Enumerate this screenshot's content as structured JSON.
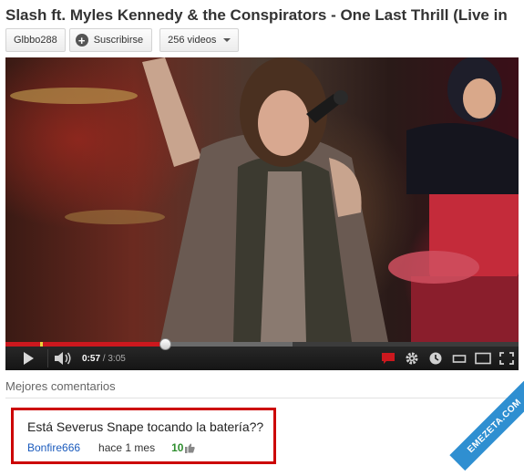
{
  "video": {
    "title": "Slash ft. Myles Kennedy & the Conspirators - One Last Thrill (Live in"
  },
  "channel": {
    "name": "Glbbo288",
    "subscribe_label": "Suscribirse",
    "videos_label": "256 videos"
  },
  "player": {
    "current_time": "0:57",
    "separator": "/",
    "duration": "3:05",
    "played_fraction": 0.31,
    "loaded_fraction": 0.56,
    "accent_color": "#cc181e"
  },
  "comments": {
    "section_label": "Mejores comentarios",
    "top": {
      "text": "Está Severus Snape tocando la batería??",
      "user": "Bonfire666",
      "time": "hace 1 mes",
      "likes": "10"
    }
  },
  "watermark": {
    "text": "EMEZETA.COM",
    "color": "#2f8fd1"
  },
  "icons": [
    "plus-icon",
    "chevron-down-icon",
    "play-icon",
    "volume-icon",
    "annotations-icon",
    "gear-icon",
    "watch-later-icon",
    "small-player-icon",
    "large-player-icon",
    "fullscreen-icon",
    "thumbs-up-icon"
  ]
}
